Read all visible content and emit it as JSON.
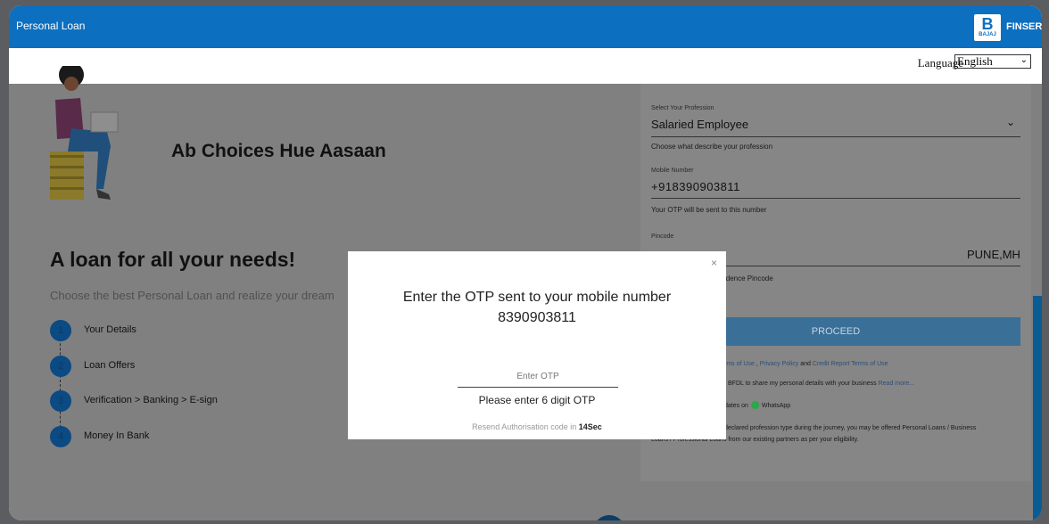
{
  "header": {
    "title": "Personal Loan",
    "logo_mark": "B",
    "logo_small": "BAJAJ",
    "logo_text": "FINSER"
  },
  "language": {
    "label": "Language",
    "selected": "English"
  },
  "hero": {
    "headline": "Ab Choices Hue Aasaan",
    "title": "A loan for all your needs!",
    "subtitle": "Choose the best Personal Loan and realize your dream"
  },
  "steps": [
    {
      "num": "1",
      "label": "Your Details"
    },
    {
      "num": "2",
      "label": "Loan Offers"
    },
    {
      "num": "3",
      "label": "Verification > Banking > E-sign"
    },
    {
      "num": "4",
      "label": "Money In Bank"
    }
  ],
  "form": {
    "profession_label": "Select Your Profession",
    "profession_value": "Salaried Employee",
    "profession_help": "Choose what describe your profession",
    "mobile_label": "Mobile Number",
    "mobile_value": "+918390903811",
    "mobile_help": "Your OTP will be sent to this number",
    "pincode_label": "Pincode",
    "pincode_city": "PUNE,MH",
    "pincode_help": "idence Pincode",
    "proceed_label": "PROCEED",
    "terms_prefix": "rms of Use",
    "terms_privacy": "Privacy Policy",
    "terms_and": "and",
    "terms_credit": "Credit Report Terms of Use",
    "consent_text": "BFDL to share my personal details with your business",
    "consent_link": "Read more...",
    "whatsapp_prefix": "dates on",
    "whatsapp_label": "WhatsApp",
    "note_line1": "declared profession type during the journey, you may be offered Personal Loans / Business",
    "note_line2": "Loans / Professional Loans from our existing partners as per your eligibility."
  },
  "modal": {
    "close": "×",
    "message_line1": "Enter the OTP sent to your mobile number",
    "message_line2": "8390903811",
    "otp_placeholder": "Enter OTP",
    "error": "Please enter 6 digit OTP",
    "resend_text": "Resend Authorisation code in",
    "resend_time": "14Sec"
  },
  "icons": {
    "profession_chevron": "chevron-down-icon",
    "language_chevron": "chevron-down-icon",
    "whatsapp": "whatsapp-icon"
  },
  "colors": {
    "brand_blue": "#0d6fbf",
    "step_circle": "#0b4a82",
    "proceed_bg": "#3a6f98",
    "whatsapp_green": "#2aa84a"
  }
}
